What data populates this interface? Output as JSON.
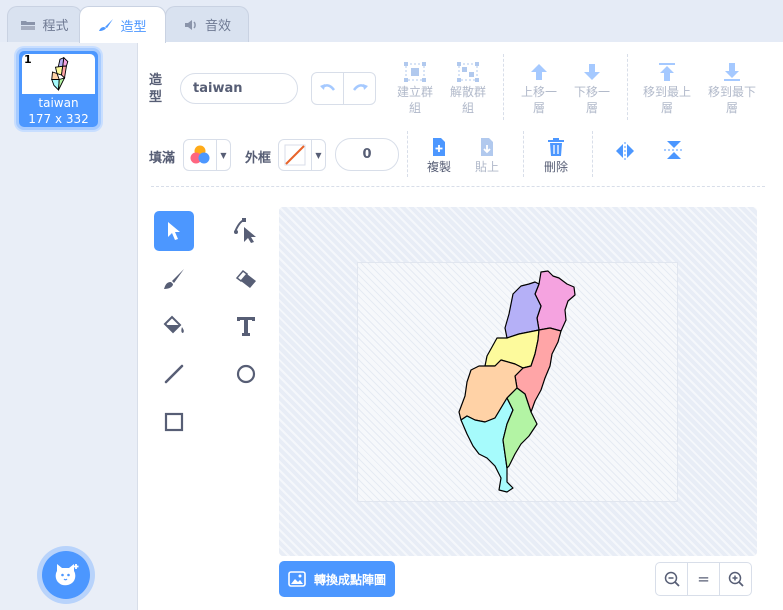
{
  "tabs": [
    {
      "label": "程式",
      "icon": "code-icon"
    },
    {
      "label": "造型",
      "icon": "brush-icon"
    },
    {
      "label": "音效",
      "icon": "sound-icon"
    }
  ],
  "costume": {
    "number": "1",
    "name": "taiwan",
    "size": "177 x 332"
  },
  "toolbar": {
    "costume_label": "造型",
    "costume_name": "taiwan",
    "group": "建立群組",
    "ungroup": "解散群組",
    "forward": "上移一層",
    "backward": "下移一層",
    "front": "移到最上層",
    "back": "移到最下層",
    "fill_label": "填滿",
    "outline_label": "外框",
    "outline_width": "0",
    "copy": "複製",
    "paste": "貼上",
    "delete": "刪除"
  },
  "colors": {
    "accent": "#4c97ff",
    "delete": "#4c97ff",
    "outline_none": "#e8642b"
  },
  "canvas": {
    "convert_label": "轉換成點陣圖",
    "zoom_reset": "="
  },
  "regions": [
    {
      "name": "north-east",
      "color": "#f5a3e0"
    },
    {
      "name": "north-west",
      "color": "#b5b0f7"
    },
    {
      "name": "central-north",
      "color": "#fdfa9c"
    },
    {
      "name": "central-east",
      "color": "#ffa5a7"
    },
    {
      "name": "west",
      "color": "#ffd2a6"
    },
    {
      "name": "south-west",
      "color": "#a6fbfc"
    },
    {
      "name": "south-east",
      "color": "#b3f4a4"
    }
  ]
}
